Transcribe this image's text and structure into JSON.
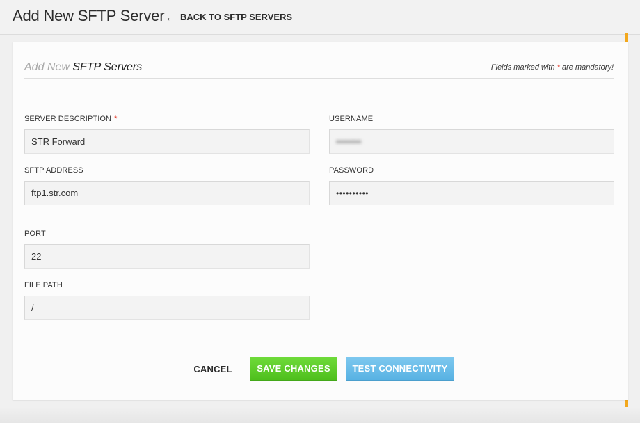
{
  "header": {
    "title": "Add New SFTP Server",
    "back_label": "BACK TO SFTP SERVERS",
    "back_icon": "arrow-left-icon"
  },
  "card": {
    "title_prefix": "Add New",
    "title_main": "SFTP Servers",
    "mandatory_note_prefix": "Fields marked with",
    "mandatory_note_star": "*",
    "mandatory_note_suffix": "are mandatory!"
  },
  "form": {
    "server_description": {
      "label": "SERVER DESCRIPTION",
      "required": "*",
      "value": "STR Forward"
    },
    "username": {
      "label": "USERNAME",
      "value": "••••••••"
    },
    "sftp_address": {
      "label": "SFTP ADDRESS",
      "value": "ftp1.str.com"
    },
    "password": {
      "label": "PASSWORD",
      "value": "••••••••••"
    },
    "port": {
      "label": "PORT",
      "value": "22"
    },
    "file_path": {
      "label": "FILE PATH",
      "value": "/"
    }
  },
  "actions": {
    "cancel_label": "CANCEL",
    "save_label": "SAVE CHANGES",
    "test_label": "TEST CONNECTIVITY"
  },
  "colors": {
    "accent": "#f3a81d",
    "save": "#5ccb28",
    "test": "#6abde9",
    "required": "#e23a2a"
  }
}
